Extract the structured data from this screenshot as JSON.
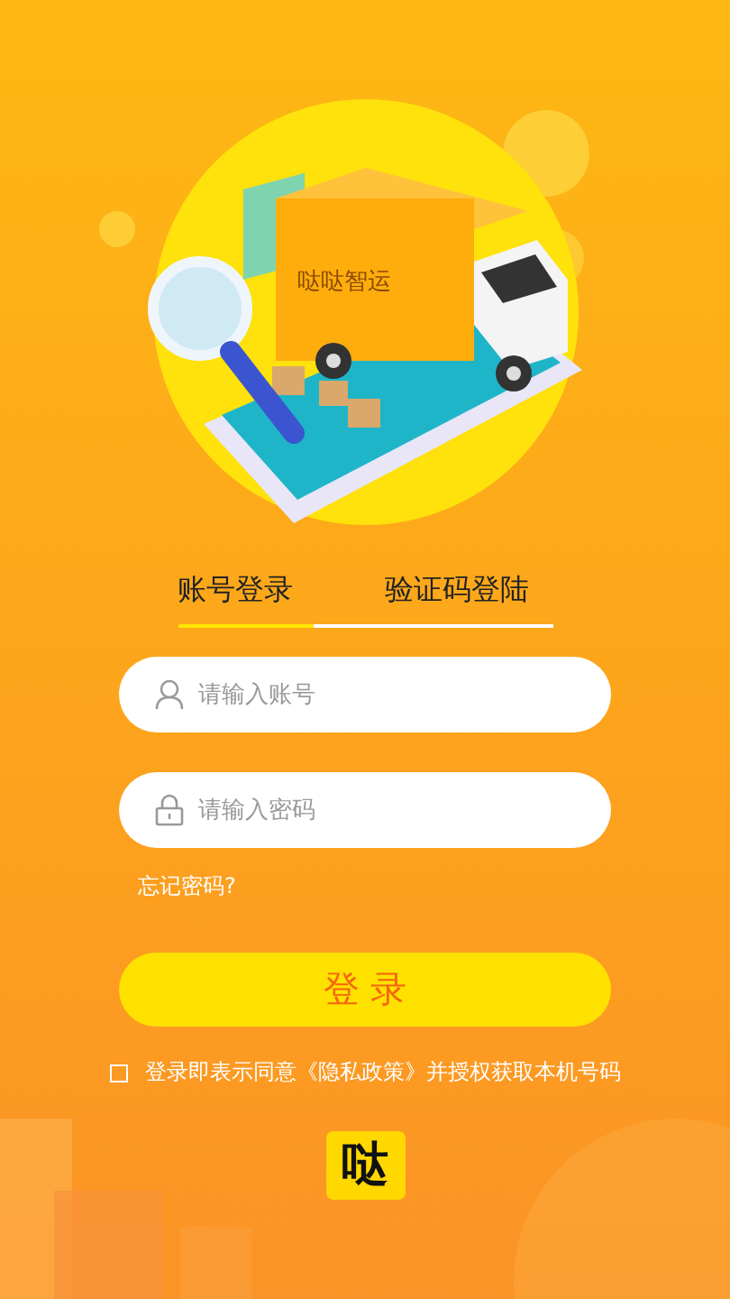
{
  "illustration": {
    "truck_label": "哒哒智运"
  },
  "tabs": [
    {
      "label": "账号登录",
      "selected": true
    },
    {
      "label": "验证码登陆",
      "selected": false
    }
  ],
  "fields": [
    {
      "kind": "account",
      "placeholder": "请输入账号"
    },
    {
      "kind": "password",
      "placeholder": "请输入密码"
    }
  ],
  "forgot_password": "忘记密码?",
  "login_button": "登 录",
  "agreement": {
    "checked": false,
    "text": "登录即表示同意《隐私政策》并授权获取本机号码"
  },
  "logo": {
    "text": "哒"
  }
}
